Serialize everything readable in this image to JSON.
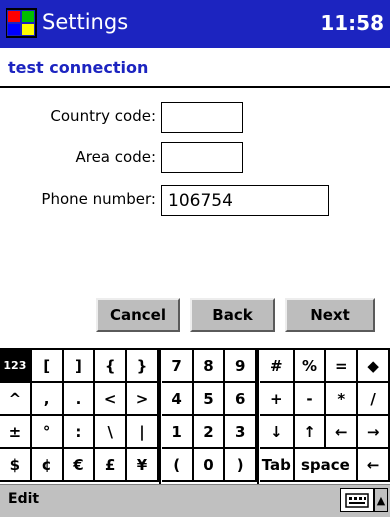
{
  "titlebar": {
    "title": "Settings",
    "time": "11:58"
  },
  "subtitle": "test connection",
  "form": {
    "country_label": "Country code:",
    "area_label": "Area code:",
    "phone_label": "Phone number:",
    "country_value": "",
    "area_value": "",
    "phone_value": "106754"
  },
  "buttons": {
    "cancel": "Cancel",
    "back": "Back",
    "next": "Next"
  },
  "keyboard": {
    "rows": [
      [
        "123",
        "[",
        "]",
        "{",
        "}",
        "7",
        "8",
        "9",
        "#",
        "%",
        "=",
        "◆"
      ],
      [
        "^",
        ",",
        ".",
        "<",
        ">",
        "4",
        "5",
        "6",
        "+",
        "-",
        "*",
        "/"
      ],
      [
        "±",
        "°",
        ":",
        "\\",
        "|",
        "1",
        "2",
        "3",
        "↓",
        "↑",
        "←",
        "→"
      ],
      [
        "$",
        "¢",
        "€",
        "£",
        "¥",
        "(",
        "0",
        ")",
        "Tab",
        "space",
        "←"
      ]
    ]
  },
  "bottombar": {
    "menu": "Edit"
  },
  "icons": [
    "windows-flag-icon",
    "keyboard-icon",
    "arrow-up-icon"
  ]
}
